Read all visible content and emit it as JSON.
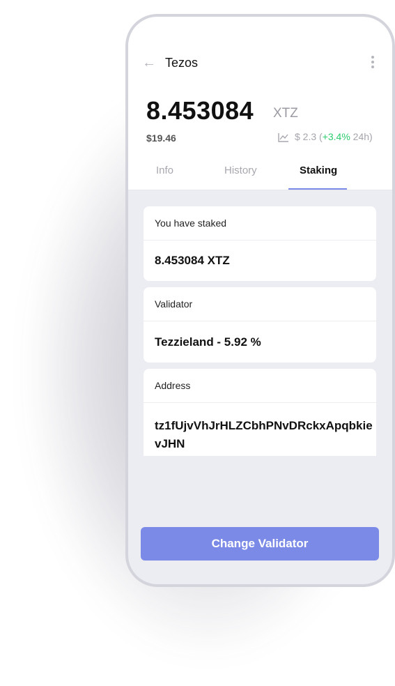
{
  "header": {
    "title": "Tezos"
  },
  "balance": {
    "amount": "8.453084",
    "ticker": "XTZ",
    "fiat": "$19.46",
    "change_prefix": "$ 2.3 (",
    "change_pct": "+3.4%",
    "change_suffix": " 24h)"
  },
  "tabs": [
    {
      "label": "Info"
    },
    {
      "label": "History"
    },
    {
      "label": "Staking"
    }
  ],
  "active_tab": "Staking",
  "staking": {
    "staked_label": "You have staked",
    "staked_value": "8.453084 XTZ",
    "validator_label": "Validator",
    "validator_value": "Tezzieland - 5.92 %",
    "address_label": "Address",
    "address_value_line1": "tz1fUjvVhJrHLZCbhPNvDRckxApqbkie",
    "address_value_line2": "vJHN"
  },
  "button": {
    "label": "Change Validator"
  },
  "colors": {
    "accent": "#7b8ae6",
    "positive": "#2ecc71"
  },
  "icons": {
    "back": "arrow-left-icon",
    "menu": "more-vertical-icon",
    "chart": "chart-line-icon"
  }
}
